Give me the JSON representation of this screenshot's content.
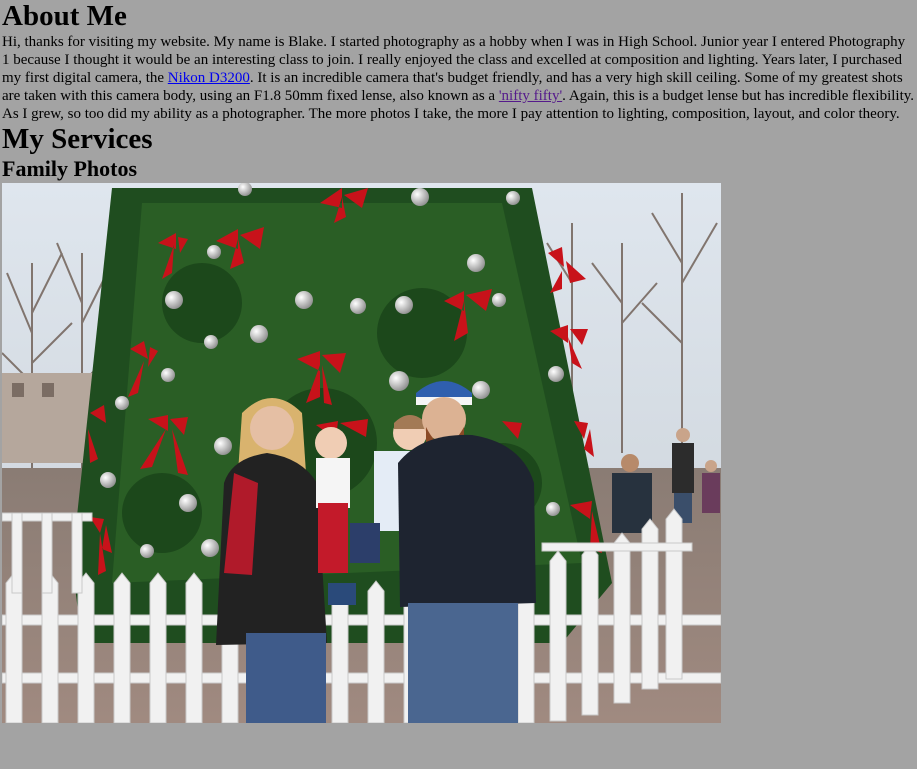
{
  "about": {
    "heading": "About Me",
    "p1_a": "Hi, thanks for visiting my website. My name is Blake. I started photography as a hobby when I was in High School. Junior year I entered Photography 1 because I thought it would be an interesting class to join. I really enjoyed the class and excelled at composition and lighting. Years later, I purchased my first digital camera, the ",
    "camera_link": "Nikon D3200",
    "p1_b": ". It is an incredible camera that's budget friendly, and has a very high skill ceiling. Some of my greatest shots are taken with this camera body, using an F1.8 50mm fixed lense, also known as a ",
    "lens_link": "'nifty fifty'",
    "p1_c": ". Again, this is a budget lense but has incredible flexibility.",
    "p2": "As I grew, so too did my ability as a photographer. The more photos I take, the more I pay attention to lighting, composition, layout, and color theory."
  },
  "services": {
    "heading": "My Services",
    "family": {
      "heading": "Family Photos"
    }
  },
  "colors": {
    "page_bg": "#a3a3a3",
    "link": "#0000ee",
    "visited_link": "#551a8b"
  }
}
